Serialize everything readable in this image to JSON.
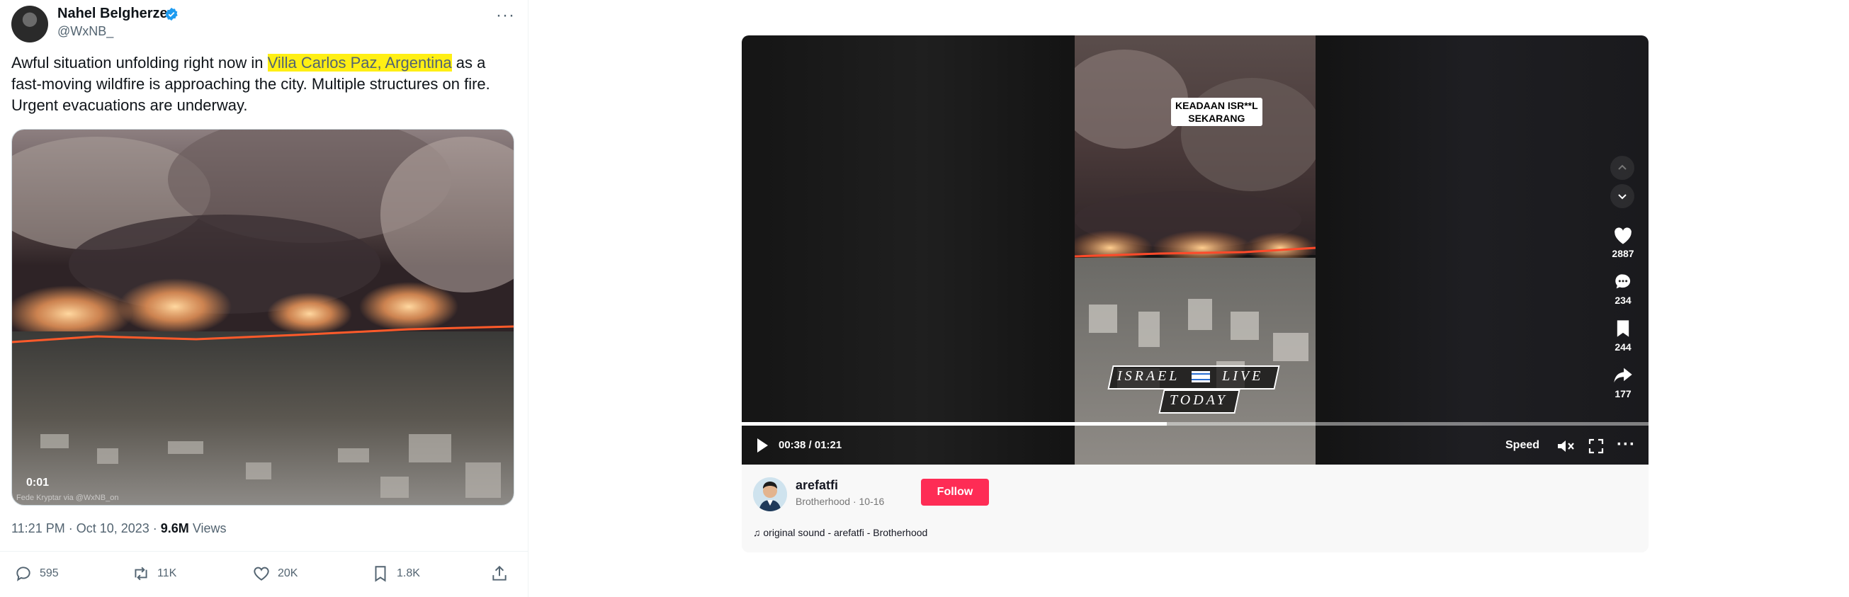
{
  "tweet": {
    "author_name": "Nahel Belgherze",
    "handle": "@WxNB_",
    "text_before": "Awful situation unfolding right now in ",
    "text_highlight": "Villa Carlos Paz, Argentina",
    "text_after": " as a fast-moving wildfire is approaching the city. Multiple structures on fire. Urgent evacuations are underway.",
    "video_time": "0:01",
    "media_credit": "Fede Kryptar via @WxNB_on",
    "timestamp": "11:21 PM · Oct 10, 2023 · ",
    "views_count": "9.6M",
    "views_label": " Views",
    "stats": {
      "replies": "595",
      "retweets": "11K",
      "likes": "20K",
      "bookmarks": "1.8K"
    },
    "colors": {
      "highlight": "#ffef14",
      "verified": "#1d9bf0"
    }
  },
  "tiktok": {
    "overlay_caption": [
      "KEADAAN ISR**L",
      "SEKARANG"
    ],
    "watermark_line1_left": "ISRAEL",
    "watermark_line1_right": "LIVE",
    "watermark_line2": "TODAY",
    "time_display": "00:38 / 01:21",
    "playback_progress_pct": 46.9,
    "speed_label": "Speed",
    "likes": "2887",
    "comments": "234",
    "saves": "244",
    "shares": "177",
    "username": "arefatfi",
    "subtitle": "Brotherhood · 10-16",
    "follow_label": "Follow",
    "sound": "original sound - arefatfi - Brotherhood",
    "colors": {
      "follow": "#fe2c55"
    }
  }
}
